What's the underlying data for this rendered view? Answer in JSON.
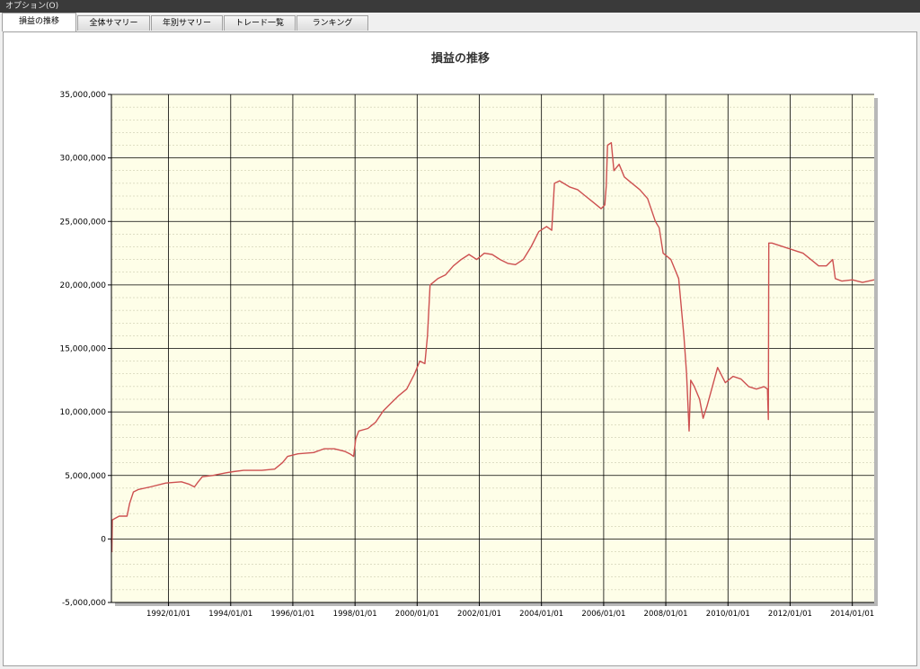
{
  "menu": {
    "options_label": "オプション(O)"
  },
  "tabs": [
    {
      "label": "損益の推移",
      "active": true
    },
    {
      "label": "全体サマリー",
      "active": false
    },
    {
      "label": "年別サマリー",
      "active": false
    },
    {
      "label": "トレード一覧",
      "active": false
    },
    {
      "label": "ランキング",
      "active": false
    }
  ],
  "chart_data": {
    "type": "line",
    "title": "損益の推移",
    "xlabel": "",
    "ylabel": "",
    "ylim": [
      -5000000,
      35000000
    ],
    "xlim": [
      "1990/03/01",
      "2014/09/15"
    ],
    "grid": true,
    "legend": "none",
    "colors": {
      "line": "#cd5050",
      "plot_bg": "#fefee8",
      "minor_grid": "#c0c0a0",
      "major_grid": "#000000"
    },
    "y_tick_labels": [
      "-5,000,000",
      "0",
      "5,000,000",
      "10,000,000",
      "15,000,000",
      "20,000,000",
      "25,000,000",
      "30,000,000",
      "35,000,000"
    ],
    "x_tick_labels": [
      "1992/01/01",
      "1994/01/01",
      "1996/01/01",
      "1998/01/01",
      "2000/01/01",
      "2002/01/01",
      "2004/01/01",
      "2006/01/01",
      "2008/01/01",
      "2010/01/01",
      "2012/01/01",
      "2014/01/01"
    ],
    "series": [
      {
        "points": [
          [
            "1990/03/01",
            0
          ],
          [
            "1990/03/06",
            -1000000
          ],
          [
            "1990/03/12",
            1500000
          ],
          [
            "1990/06/01",
            1800000
          ],
          [
            "1990/09/01",
            1800000
          ],
          [
            "1990/10/01",
            2800000
          ],
          [
            "1990/11/15",
            3700000
          ],
          [
            "1991/01/15",
            3900000
          ],
          [
            "1991/06/01",
            4100000
          ],
          [
            "1991/12/01",
            4400000
          ],
          [
            "1992/06/01",
            4500000
          ],
          [
            "1992/09/01",
            4300000
          ],
          [
            "1992/11/01",
            4100000
          ],
          [
            "1992/12/15",
            4500000
          ],
          [
            "1993/02/01",
            4900000
          ],
          [
            "1993/06/01",
            5000000
          ],
          [
            "1993/11/01",
            5200000
          ],
          [
            "1994/02/01",
            5300000
          ],
          [
            "1994/06/01",
            5400000
          ],
          [
            "1994/09/01",
            5400000
          ],
          [
            "1995/01/01",
            5400000
          ],
          [
            "1995/06/01",
            5500000
          ],
          [
            "1995/09/01",
            6000000
          ],
          [
            "1995/11/01",
            6500000
          ],
          [
            "1996/03/01",
            6700000
          ],
          [
            "1996/09/01",
            6800000
          ],
          [
            "1997/01/01",
            7100000
          ],
          [
            "1997/05/01",
            7100000
          ],
          [
            "1997/09/01",
            6900000
          ],
          [
            "1997/11/01",
            6700000
          ],
          [
            "1997/12/15",
            6500000
          ],
          [
            "1998/01/10",
            7900000
          ],
          [
            "1998/02/15",
            8500000
          ],
          [
            "1998/06/01",
            8700000
          ],
          [
            "1998/09/01",
            9200000
          ],
          [
            "1998/12/01",
            10100000
          ],
          [
            "1999/03/01",
            10700000
          ],
          [
            "1999/06/01",
            11300000
          ],
          [
            "1999/09/01",
            11800000
          ],
          [
            "1999/12/01",
            13000000
          ],
          [
            "2000/02/01",
            14000000
          ],
          [
            "2000/04/01",
            13800000
          ],
          [
            "2000/05/01",
            16000000
          ],
          [
            "2000/06/01",
            20000000
          ],
          [
            "2000/09/01",
            20500000
          ],
          [
            "2000/12/01",
            20800000
          ],
          [
            "2001/03/01",
            21500000
          ],
          [
            "2001/06/01",
            22000000
          ],
          [
            "2001/09/01",
            22400000
          ],
          [
            "2001/12/01",
            22000000
          ],
          [
            "2002/03/01",
            22500000
          ],
          [
            "2002/06/01",
            22400000
          ],
          [
            "2002/09/01",
            22000000
          ],
          [
            "2002/12/01",
            21700000
          ],
          [
            "2003/03/01",
            21600000
          ],
          [
            "2003/06/01",
            22000000
          ],
          [
            "2003/09/01",
            23000000
          ],
          [
            "2003/12/01",
            24200000
          ],
          [
            "2004/03/01",
            24600000
          ],
          [
            "2004/05/01",
            24300000
          ],
          [
            "2004/06/01",
            28000000
          ],
          [
            "2004/08/01",
            28200000
          ],
          [
            "2004/12/01",
            27700000
          ],
          [
            "2005/03/01",
            27500000
          ],
          [
            "2005/06/01",
            27000000
          ],
          [
            "2005/09/01",
            26500000
          ],
          [
            "2005/12/01",
            26000000
          ],
          [
            "2006/01/15",
            26300000
          ],
          [
            "2006/02/01",
            27800000
          ],
          [
            "2006/02/15",
            31000000
          ],
          [
            "2006/04/01",
            31200000
          ],
          [
            "2006/05/01",
            29000000
          ],
          [
            "2006/07/01",
            29500000
          ],
          [
            "2006/09/01",
            28500000
          ],
          [
            "2006/12/01",
            28000000
          ],
          [
            "2007/03/01",
            27500000
          ],
          [
            "2007/06/01",
            26800000
          ],
          [
            "2007/09/01",
            25000000
          ],
          [
            "2007/10/15",
            24500000
          ],
          [
            "2007/12/01",
            22500000
          ],
          [
            "2008/03/01",
            22000000
          ],
          [
            "2008/06/01",
            20500000
          ],
          [
            "2008/08/01",
            16000000
          ],
          [
            "2008/09/01",
            13000000
          ],
          [
            "2008/10/01",
            8500000
          ],
          [
            "2008/10/20",
            12500000
          ],
          [
            "2008/12/01",
            12000000
          ],
          [
            "2009/02/01",
            11000000
          ],
          [
            "2009/03/15",
            9500000
          ],
          [
            "2009/05/01",
            10500000
          ],
          [
            "2009/07/01",
            12000000
          ],
          [
            "2009/09/01",
            13500000
          ],
          [
            "2009/12/01",
            12300000
          ],
          [
            "2010/03/01",
            12800000
          ],
          [
            "2010/06/01",
            12600000
          ],
          [
            "2010/09/01",
            12000000
          ],
          [
            "2010/12/01",
            11800000
          ],
          [
            "2011/03/01",
            12000000
          ],
          [
            "2011/04/10",
            11800000
          ],
          [
            "2011/04/20",
            9400000
          ],
          [
            "2011/04/25",
            23300000
          ],
          [
            "2011/06/01",
            23300000
          ],
          [
            "2011/12/01",
            22900000
          ],
          [
            "2012/06/01",
            22500000
          ],
          [
            "2012/09/01",
            22000000
          ],
          [
            "2012/12/01",
            21500000
          ],
          [
            "2013/03/01",
            21500000
          ],
          [
            "2013/05/15",
            22000000
          ],
          [
            "2013/06/15",
            20500000
          ],
          [
            "2013/09/01",
            20300000
          ],
          [
            "2014/01/01",
            20400000
          ],
          [
            "2014/05/01",
            20200000
          ],
          [
            "2014/09/15",
            20400000
          ]
        ]
      }
    ]
  }
}
